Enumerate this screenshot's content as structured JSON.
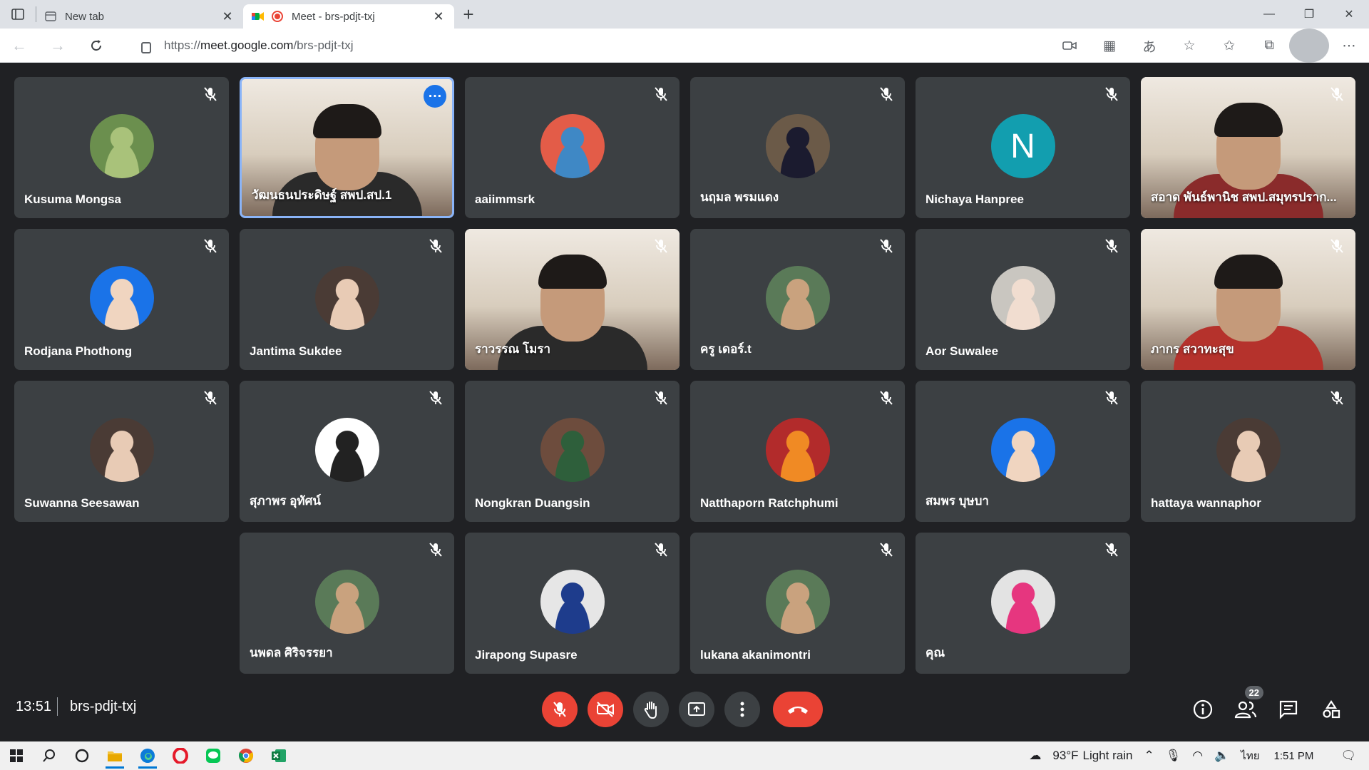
{
  "browser": {
    "tabs": [
      {
        "title": "New tab",
        "active": false
      },
      {
        "title": "Meet - brs-pdjt-txj",
        "active": true
      }
    ],
    "address": {
      "scheme": "https://",
      "host": "meet.google.com",
      "path": "/brs-pdjt-txj"
    }
  },
  "participants": [
    {
      "name": "Kusuma Mongsa",
      "avatar": "photo-nature",
      "mic": "muted"
    },
    {
      "name": "วัฒนธนประดิษฐ์ สพป.สป.1",
      "avatar": "video",
      "mic": "active",
      "speaker": true
    },
    {
      "name": "aaiimmsrk",
      "avatar": "cartoon-shark",
      "mic": "muted"
    },
    {
      "name": "นฤมล พรมแดง",
      "avatar": "photo-graduate",
      "mic": "muted"
    },
    {
      "name": "Nichaya Hanpree",
      "avatar": "letter",
      "letter": "N",
      "mic": "muted"
    },
    {
      "name": "สอาด พันธ์พานิช สพป.สมุทรปราก...",
      "avatar": "video",
      "mic": "muted"
    },
    {
      "name": "Rodjana Phothong",
      "avatar": "photo-portrait",
      "mic": "muted"
    },
    {
      "name": "Jantima Sukdee",
      "avatar": "photo-woman",
      "mic": "muted"
    },
    {
      "name": "ราวรรณ โมรา",
      "avatar": "video",
      "mic": "muted"
    },
    {
      "name": "ครู เดอร์.t",
      "avatar": "photo-man",
      "mic": "muted"
    },
    {
      "name": "Aor Suwalee",
      "avatar": "photo-woman-light",
      "mic": "muted"
    },
    {
      "name": "ภากร สวาทะสุข",
      "avatar": "video",
      "mic": "muted"
    },
    {
      "name": "Suwanna Seesawan",
      "avatar": "photo-woman",
      "mic": "muted"
    },
    {
      "name": "สุภาพร อุทัศน์",
      "avatar": "cartoon-couple",
      "mic": "muted"
    },
    {
      "name": "Nongkran Duangsin",
      "avatar": "photo-group",
      "mic": "muted"
    },
    {
      "name": "Natthaporn Ratchphumi",
      "avatar": "photo-couple",
      "mic": "muted"
    },
    {
      "name": "สมพร บุษบา",
      "avatar": "photo-portrait",
      "mic": "muted"
    },
    {
      "name": "hattaya wannaphor",
      "avatar": "photo-woman",
      "mic": "muted"
    },
    {
      "name": "นพดล ศิริจรรยา",
      "avatar": "photo-man",
      "mic": "muted"
    },
    {
      "name": "Jirapong Supasre",
      "avatar": "emblem",
      "mic": "muted"
    },
    {
      "name": "lukana akanimontri",
      "avatar": "photo-man",
      "mic": "muted"
    },
    {
      "name": "คุณ",
      "avatar": "photo-woman-pink",
      "mic": "muted"
    }
  ],
  "meeting": {
    "time": "13:51",
    "code": "brs-pdjt-txj",
    "participant_count": "22"
  },
  "taskbar": {
    "temperature": "93°F",
    "weather": "Light rain",
    "language": "ไทย",
    "clock": "1:51 PM"
  },
  "colors": {
    "meet_bg": "#202124",
    "tile_bg": "#3c4043",
    "danger": "#ea4335",
    "speaker_border": "#8ab4f8",
    "letter_avatar": "#129eaf"
  }
}
